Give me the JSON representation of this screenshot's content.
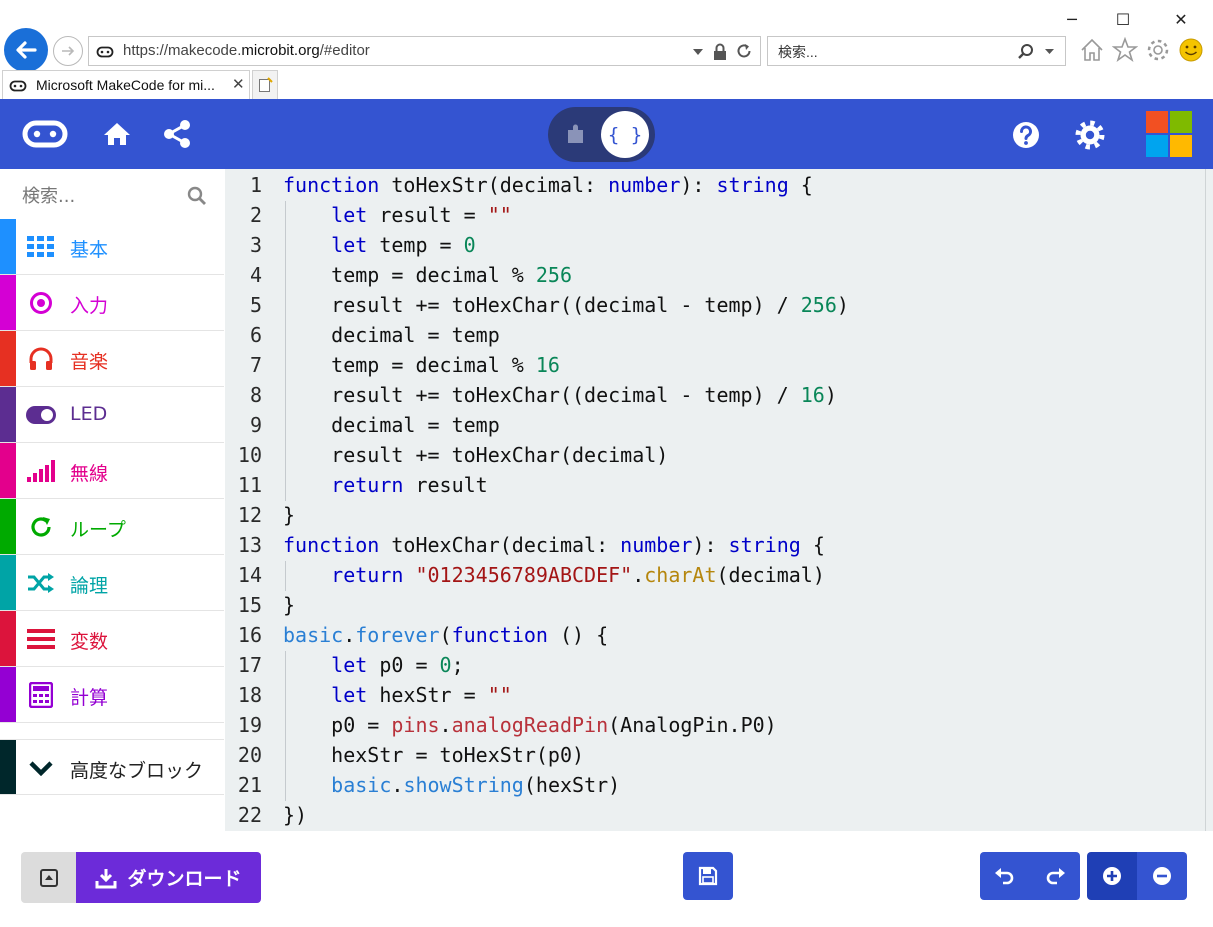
{
  "browser": {
    "window_controls": {
      "minimize": "─",
      "maximize": "☐",
      "close": "✕"
    },
    "url": {
      "prefix": "https://makecode.",
      "domain": "microbit.org",
      "suffix": "/#editor"
    },
    "search_placeholder": "検索...",
    "tab_title": "Microsoft MakeCode for mi...",
    "tab_close": "✕"
  },
  "header": {
    "toggle_code_label": "{ }"
  },
  "toolbox": {
    "search_placeholder": "検索...",
    "categories": [
      {
        "label": "基本",
        "color": "#1e90ff",
        "icon": "grid-icon"
      },
      {
        "label": "入力",
        "color": "#d400d4",
        "icon": "target-icon"
      },
      {
        "label": "音楽",
        "color": "#e63022",
        "icon": "headphones-icon"
      },
      {
        "label": "LED",
        "color": "#5c2d91",
        "icon": "toggle-icon"
      },
      {
        "label": "無線",
        "color": "#e3008c",
        "icon": "signal-bars-icon"
      },
      {
        "label": "ループ",
        "color": "#00aa00",
        "icon": "refresh-icon"
      },
      {
        "label": "論理",
        "color": "#00a4a6",
        "icon": "shuffle-icon"
      },
      {
        "label": "変数",
        "color": "#dc143c",
        "icon": "lines-icon"
      },
      {
        "label": "計算",
        "color": "#9400d3",
        "icon": "calculator-icon"
      }
    ],
    "advanced": {
      "label": "高度なブロック",
      "color": "#00272b",
      "icon": "chevron-down-icon"
    }
  },
  "editor": {
    "line_numbers": [
      "1",
      "2",
      "3",
      "4",
      "5",
      "6",
      "7",
      "8",
      "9",
      "10",
      "11",
      "12",
      "13",
      "14",
      "15",
      "16",
      "17",
      "18",
      "19",
      "20",
      "21",
      "22"
    ],
    "code_lines": [
      "function toHexStr(decimal: number): string {",
      "    let result = \"\"",
      "    let temp = 0",
      "    temp = decimal % 256",
      "    result += toHexChar((decimal - temp) / 256)",
      "    decimal = temp",
      "    temp = decimal % 16",
      "    result += toHexChar((decimal - temp) / 16)",
      "    decimal = temp",
      "    result += toHexChar(decimal)",
      "    return result",
      "}",
      "function toHexChar(decimal: number): string {",
      "    return \"0123456789ABCDEF\".charAt(decimal)",
      "}",
      "basic.forever(function () {",
      "    let p0 = 0;",
      "    let hexStr = \"\"",
      "    p0 = pins.analogReadPin(AnalogPin.P0)",
      "    hexStr = toHexStr(p0)",
      "    basic.showString(hexStr)",
      "})"
    ]
  },
  "bottom": {
    "download_label": "ダウンロード"
  },
  "colors": {
    "header_blue": "#3454d1",
    "download_purple": "#6c2bd9",
    "editor_bg": "#ecf0f1"
  }
}
